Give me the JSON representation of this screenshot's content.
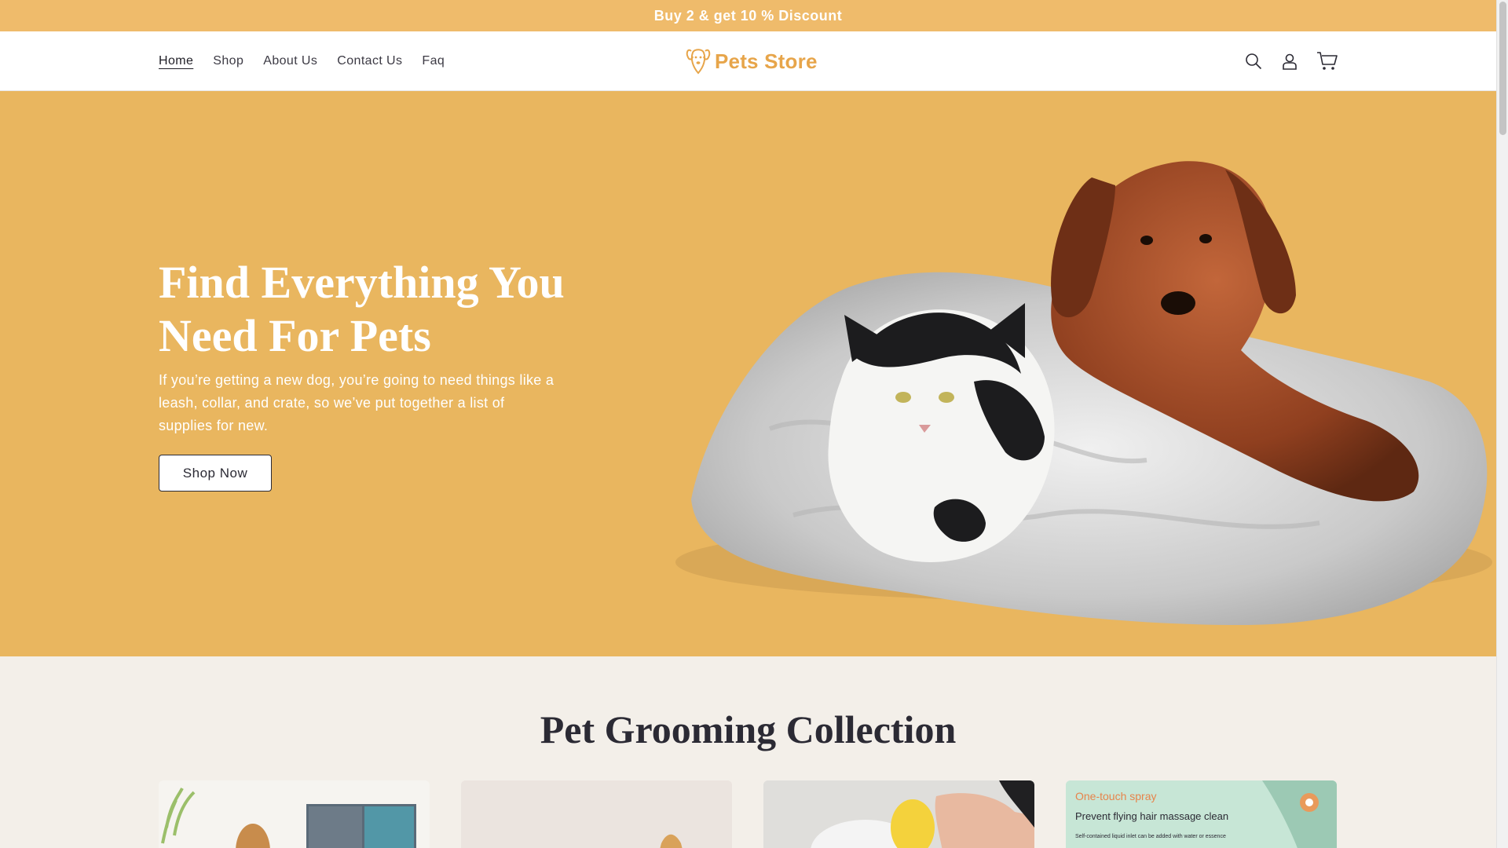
{
  "announcement": {
    "text": "Buy 2 & get 10 % Discount"
  },
  "nav": {
    "items": [
      {
        "label": "Home",
        "active": true
      },
      {
        "label": "Shop",
        "active": false
      },
      {
        "label": "About Us",
        "active": false
      },
      {
        "label": "Contact Us",
        "active": false
      },
      {
        "label": "Faq",
        "active": false
      }
    ]
  },
  "logo": {
    "text": "Pets Store"
  },
  "header_icons": [
    "search-icon",
    "account-icon",
    "cart-icon"
  ],
  "hero": {
    "title_line1": "Find Everything You",
    "title_line2": "Need For Pets",
    "description": "If you’re getting a new dog, you’re going to need things like a leash, collar, and crate, so we’ve put together a list of supplies for new.",
    "button_label": "Shop Now",
    "background_color": "#e9b65f"
  },
  "collection": {
    "title": "Pet Grooming Collection",
    "cards": [
      {
        "caption_line1": "",
        "caption_line2": "",
        "caption_line3": ""
      },
      {
        "caption_line1": "",
        "caption_line2": "",
        "caption_line3": ""
      },
      {
        "caption_line1": "",
        "caption_line2": "",
        "caption_line3": ""
      },
      {
        "caption_line1": "One-touch spray",
        "caption_line2": "Prevent flying hair massage clean",
        "caption_line3": "Self-contained liquid inlet can be added with water or essence"
      }
    ]
  },
  "colors": {
    "announcement_bg": "#efbb6b",
    "accent": "#e7a54a",
    "text_dark": "#2b2a34",
    "page_bg": "#f3efe9"
  }
}
